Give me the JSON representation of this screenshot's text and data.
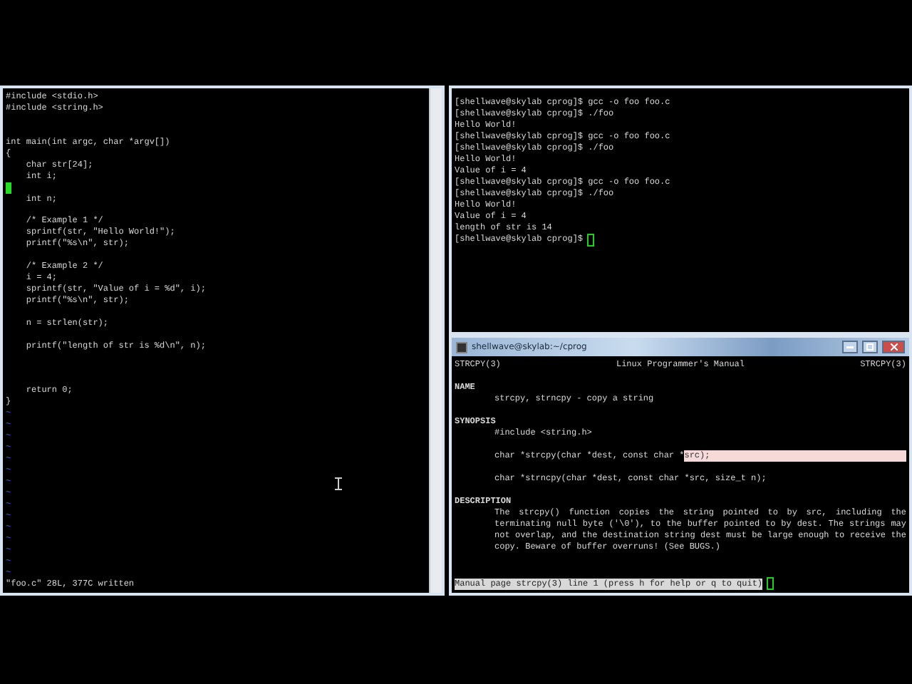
{
  "editor": {
    "lines": [
      {
        "text": "#include <stdio.h>",
        "cursor": false
      },
      {
        "text": "#include <string.h>",
        "cursor": false
      },
      {
        "cursor": false
      },
      {
        "cursor": false
      },
      {
        "text": "int main(int argc, char *argv[])",
        "cursor": false
      },
      {
        "text": "{",
        "cursor": false
      },
      {
        "text": "    char str[24];",
        "cursor": false
      },
      {
        "text": "    int i;",
        "cursor": false
      },
      {
        "cursor": true
      },
      {
        "text": "    int n;",
        "cursor": false
      },
      {
        "cursor": false
      },
      {
        "text": "    /* Example 1 */",
        "cursor": false
      },
      {
        "text": "    sprintf(str, \"Hello World!\");",
        "cursor": false
      },
      {
        "text": "    printf(\"%s\\n\", str);",
        "cursor": false
      },
      {
        "cursor": false
      },
      {
        "text": "    /* Example 2 */",
        "cursor": false
      },
      {
        "text": "    i = 4;",
        "cursor": false
      },
      {
        "text": "    sprintf(str, \"Value of i = %d\", i);",
        "cursor": false
      },
      {
        "text": "    printf(\"%s\\n\", str);",
        "cursor": false
      },
      {
        "cursor": false
      },
      {
        "text": "    n = strlen(str);",
        "cursor": false
      },
      {
        "cursor": false
      },
      {
        "text": "    printf(\"length of str is %d\\n\", n);",
        "cursor": false
      },
      {
        "cursor": false
      },
      {
        "cursor": false
      },
      {
        "cursor": false
      },
      {
        "text": "    return 0;",
        "cursor": false
      },
      {
        "text": "}",
        "cursor": false
      }
    ],
    "tildes": [
      "~",
      "~",
      "~",
      "~",
      "~",
      "~",
      "~",
      "~",
      "~",
      "~",
      "~",
      "~",
      "~",
      "~",
      "~"
    ],
    "status": "\"foo.c\" 28L, 377C written"
  },
  "terminal": {
    "lines": [
      "[shellwave@skylab cprog]$ gcc -o foo foo.c",
      "[shellwave@skylab cprog]$ ./foo",
      "Hello World!",
      "[shellwave@skylab cprog]$ gcc -o foo foo.c",
      "[shellwave@skylab cprog]$ ./foo",
      "Hello World!",
      "Value of i = 4",
      "[shellwave@skylab cprog]$ gcc -o foo foo.c",
      "[shellwave@skylab cprog]$ ./foo",
      "Hello World!",
      "Value of i = 4",
      "length of str is 14"
    ],
    "prompt": "[shellwave@skylab cprog]$"
  },
  "man_window": {
    "title": "shellwave@skylab:~/cprog",
    "header": [
      "STRCPY(3)",
      "Linux Programmer's Manual",
      "STRCPY(3)"
    ],
    "lines": [
      {
        "kind": "blank"
      },
      {
        "kind": "heading",
        "text": "NAME"
      },
      {
        "kind": "body",
        "text": "strcpy, strncpy - copy a string"
      },
      {
        "kind": "blank"
      },
      {
        "kind": "heading",
        "text": "SYNOPSIS"
      },
      {
        "kind": "body",
        "text": "#include <string.h>"
      },
      {
        "kind": "blank"
      },
      {
        "kind": "highlight",
        "text": "char *strcpy(char *dest, const char *",
        "highlight": "src);"
      },
      {
        "kind": "blank"
      },
      {
        "kind": "body",
        "text": "char *strncpy(char *dest, const char *src, size_t n);"
      },
      {
        "kind": "blank"
      },
      {
        "kind": "heading",
        "text": "DESCRIPTION"
      },
      {
        "kind": "paragraph",
        "text": "The strcpy() function copies the string pointed to by src, including the terminating null byte ('\\0'), to the buffer pointed to by dest. The strings may not overlap, and the destination string dest must be large enough to receive the copy. Beware of buffer overruns! (See BUGS.)"
      }
    ],
    "status": "Manual page strcpy(3) line 1 (press h for help or q to quit)"
  }
}
